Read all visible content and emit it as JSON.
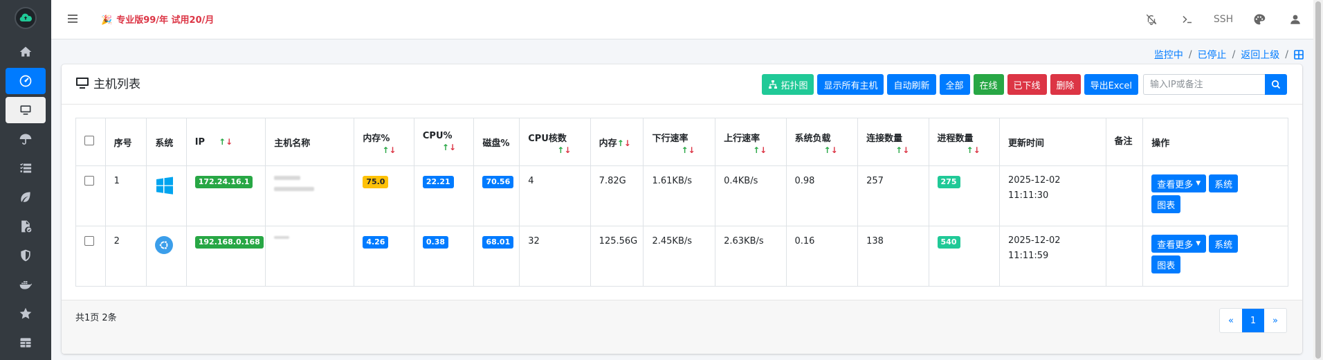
{
  "topbar": {
    "promo": "专业版99/年 试用20/月",
    "ssh_label": "SSH"
  },
  "sidebar": {
    "items": [
      {
        "name": "home-icon"
      },
      {
        "name": "dashboard-icon"
      },
      {
        "name": "desktop-icon"
      },
      {
        "name": "umbrella-icon"
      },
      {
        "name": "task-list-icon"
      },
      {
        "name": "leaf-icon"
      },
      {
        "name": "file-check-icon"
      },
      {
        "name": "shield-icon"
      },
      {
        "name": "docker-icon"
      },
      {
        "name": "star-icon"
      },
      {
        "name": "table-icon"
      }
    ]
  },
  "breadcrumb": {
    "monitoring": "监控中",
    "stopped": "已停止",
    "back": "返回上级",
    "sep": "/"
  },
  "card": {
    "title": "主机列表",
    "buttons": {
      "topology": "拓扑图",
      "show_all": "显示所有主机",
      "auto_refresh": "自动刷新",
      "all": "全部",
      "online": "在线",
      "offline": "已下线",
      "delete": "删除",
      "export": "导出Excel"
    },
    "search_placeholder": "输入IP或备注"
  },
  "table": {
    "headers": {
      "index": "序号",
      "os": "系统",
      "ip": "IP",
      "hostname": "主机名称",
      "mem_pct": "内存%",
      "cpu_pct": "CPU%",
      "disk_pct": "磁盘%",
      "cpu_cores": "CPU核数",
      "memory": "内存",
      "down_speed": "下行速率",
      "up_speed": "上行速率",
      "load": "系统负载",
      "connections": "连接数量",
      "processes": "进程数量",
      "updated": "更新时间",
      "note": "备注",
      "actions": "操作"
    },
    "sort_up": "↑",
    "sort_down": "↓",
    "rows": [
      {
        "index": "1",
        "os": "windows-icon",
        "ip": "172.24.16.1",
        "mem_pct": "75.0",
        "cpu_pct": "22.21",
        "disk_pct": "70.56",
        "cpu_cores": "4",
        "memory": "7.82G",
        "down_speed": "1.61KB/s",
        "up_speed": "0.4KB/s",
        "load": "0.98",
        "connections": "257",
        "processes": "275",
        "updated_date": "2025-12-02",
        "updated_time": "11:11:30",
        "note": ""
      },
      {
        "index": "2",
        "os": "ubuntu-icon",
        "ip": "192.168.0.168",
        "mem_pct": "4.26",
        "cpu_pct": "0.38",
        "disk_pct": "68.01",
        "cpu_cores": "32",
        "memory": "125.56G",
        "down_speed": "2.45KB/s",
        "up_speed": "2.63KB/s",
        "load": "0.16",
        "connections": "138",
        "processes": "540",
        "updated_date": "2025-12-02",
        "updated_time": "11:11:59",
        "note": ""
      }
    ],
    "actions": {
      "more": "查看更多",
      "system": "系统",
      "chart": "图表"
    }
  },
  "footer": {
    "summary": "共1页 2条",
    "pager": {
      "prev": "«",
      "current": "1",
      "next": "»"
    }
  },
  "colors": {
    "sidebar_bg": "#343a40",
    "primary": "#007bff",
    "success": "#28a745",
    "danger": "#dc3545",
    "teal": "#20c997",
    "warning": "#ffc107"
  }
}
